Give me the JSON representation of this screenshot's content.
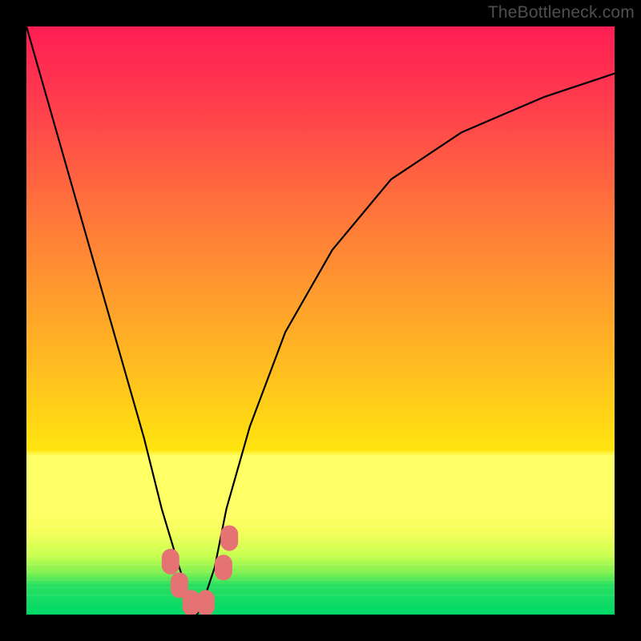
{
  "watermark": "TheBottleneck.com",
  "chart_data": {
    "type": "line",
    "title": "",
    "xlabel": "",
    "ylabel": "",
    "xlim": [
      0,
      100
    ],
    "ylim": [
      0,
      100
    ],
    "background_gradient": {
      "top": "#ff2850",
      "mid": "#ffd400",
      "bottom": "#00e060",
      "strong_yellow_band_y": [
        72,
        84
      ],
      "green_band_y": [
        93,
        100
      ]
    },
    "curve": {
      "description": "V-shaped bottleneck curve, minimum near x≈29",
      "x": [
        0,
        4,
        8,
        12,
        16,
        20,
        23,
        26,
        28,
        29,
        30,
        32,
        34,
        38,
        44,
        52,
        62,
        74,
        88,
        100
      ],
      "y": [
        100,
        86,
        72,
        58,
        44,
        30,
        18,
        8,
        2,
        0,
        2,
        8,
        18,
        32,
        48,
        62,
        74,
        82,
        88,
        92
      ]
    },
    "markers": {
      "color": "#e57373",
      "description": "salmon rounded markers near curve minimum",
      "points": [
        {
          "x": 24.5,
          "y": 9.0
        },
        {
          "x": 26.0,
          "y": 5.0
        },
        {
          "x": 28.0,
          "y": 2.0
        },
        {
          "x": 30.5,
          "y": 2.0
        },
        {
          "x": 33.5,
          "y": 8.0
        },
        {
          "x": 34.5,
          "y": 13.0
        }
      ]
    }
  }
}
